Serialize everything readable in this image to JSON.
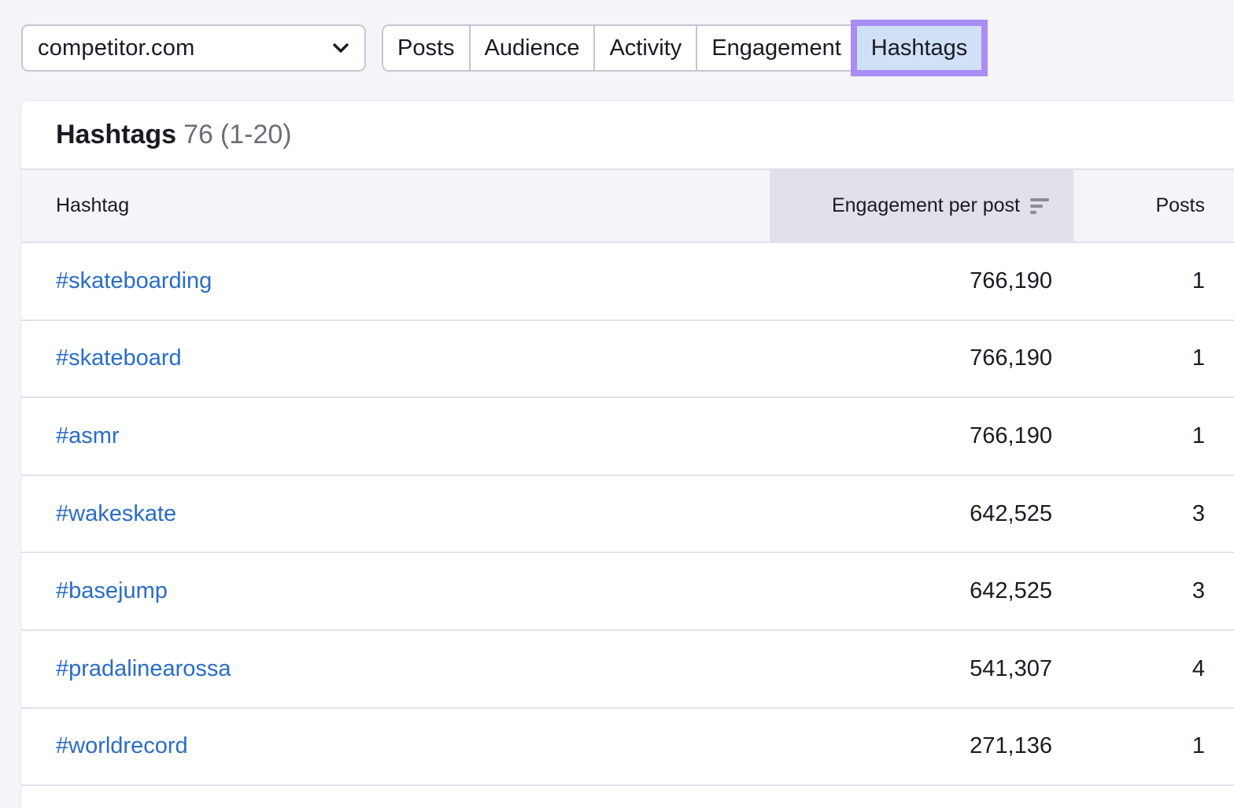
{
  "domain_select": {
    "value": "competitor.com",
    "icon": "chevron-down-icon"
  },
  "tabs": [
    {
      "label": "Posts",
      "selected": false
    },
    {
      "label": "Audience",
      "selected": false
    },
    {
      "label": "Activity",
      "selected": false
    },
    {
      "label": "Engagement",
      "selected": false
    },
    {
      "label": "Hashtags",
      "selected": true
    }
  ],
  "card": {
    "title": "Hashtags",
    "count": "76",
    "range": "(1-20)"
  },
  "table": {
    "columns": [
      {
        "label": "Hashtag"
      },
      {
        "label": "Engagement per post",
        "sorted": true,
        "sort_icon": "sort-descending-icon"
      },
      {
        "label": "Posts"
      }
    ],
    "rows": [
      {
        "hashtag": "#skateboarding",
        "engagement_per_post": "766,190",
        "posts": "1"
      },
      {
        "hashtag": "#skateboard",
        "engagement_per_post": "766,190",
        "posts": "1"
      },
      {
        "hashtag": "#asmr",
        "engagement_per_post": "766,190",
        "posts": "1"
      },
      {
        "hashtag": "#wakeskate",
        "engagement_per_post": "642,525",
        "posts": "3"
      },
      {
        "hashtag": "#basejump",
        "engagement_per_post": "642,525",
        "posts": "3"
      },
      {
        "hashtag": "#pradalinearossa",
        "engagement_per_post": "541,307",
        "posts": "4"
      },
      {
        "hashtag": "#worldrecord",
        "engagement_per_post": "271,136",
        "posts": "1"
      }
    ]
  },
  "colors": {
    "link": "#2a6cc7",
    "selected_tab_bg": "#cfe0f7",
    "selected_tab_outline": "#a98cf5",
    "sorted_column_bg": "#e0e1ea",
    "page_bg": "#f4f5f9"
  }
}
